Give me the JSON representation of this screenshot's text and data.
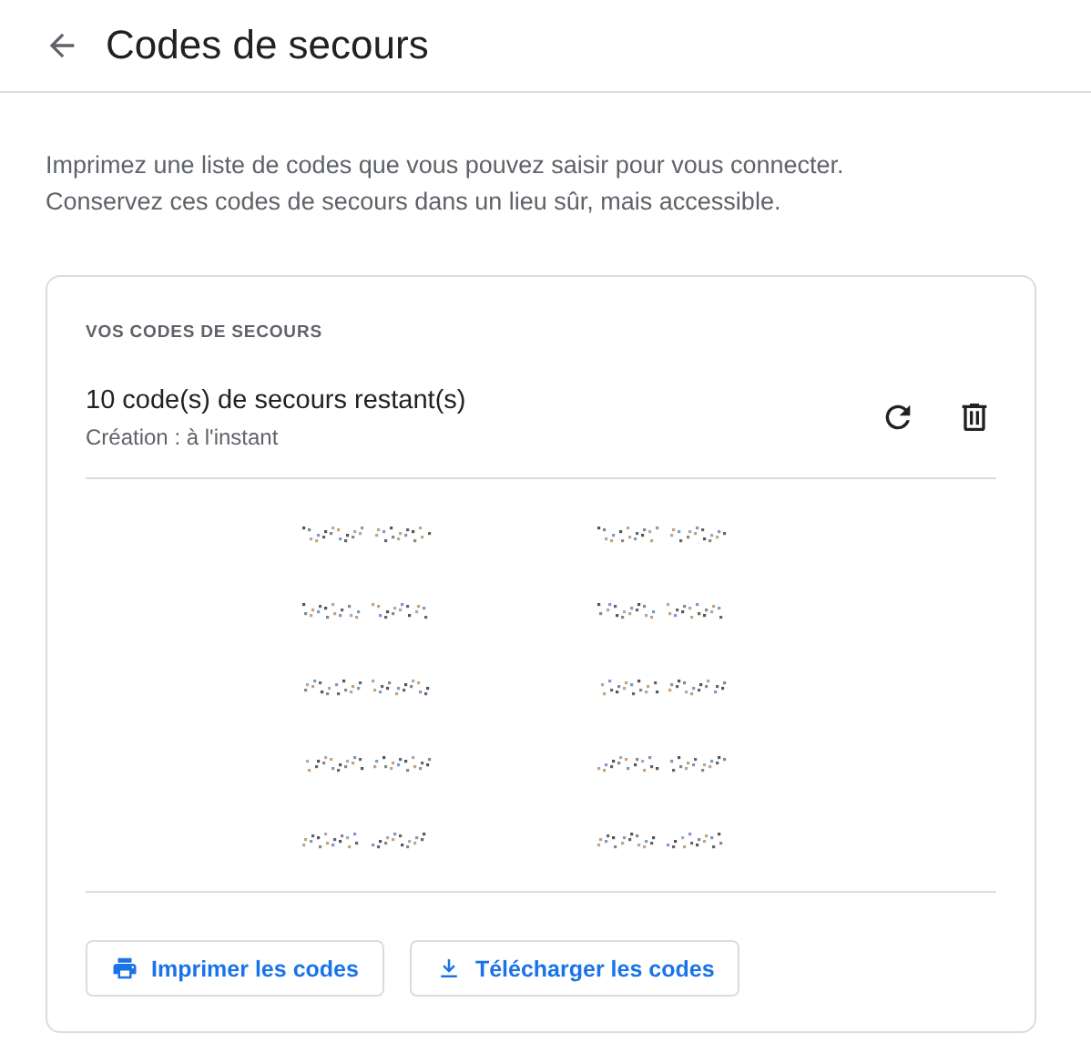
{
  "header": {
    "title": "Codes de secours"
  },
  "description": [
    "Imprimez une liste de codes que vous pouvez saisir pour vous connecter.",
    "Conservez ces codes de secours dans un lieu sûr, mais accessible."
  ],
  "card": {
    "label": "VOS CODES DE SECOURS",
    "status": "10 code(s) de secours restant(s)",
    "created": "Création : à l'instant",
    "codes": [
      {
        "kind": "redacted"
      },
      {
        "kind": "redacted"
      },
      {
        "kind": "redacted"
      },
      {
        "kind": "redacted"
      },
      {
        "kind": "redacted"
      },
      {
        "kind": "redacted"
      },
      {
        "kind": "redacted"
      },
      {
        "kind": "redacted"
      },
      {
        "kind": "redacted"
      },
      {
        "kind": "redacted"
      }
    ],
    "buttons": [
      {
        "kind": "print",
        "label": "Imprimer les codes"
      },
      {
        "kind": "download",
        "label": "Télécharger les codes"
      }
    ]
  }
}
